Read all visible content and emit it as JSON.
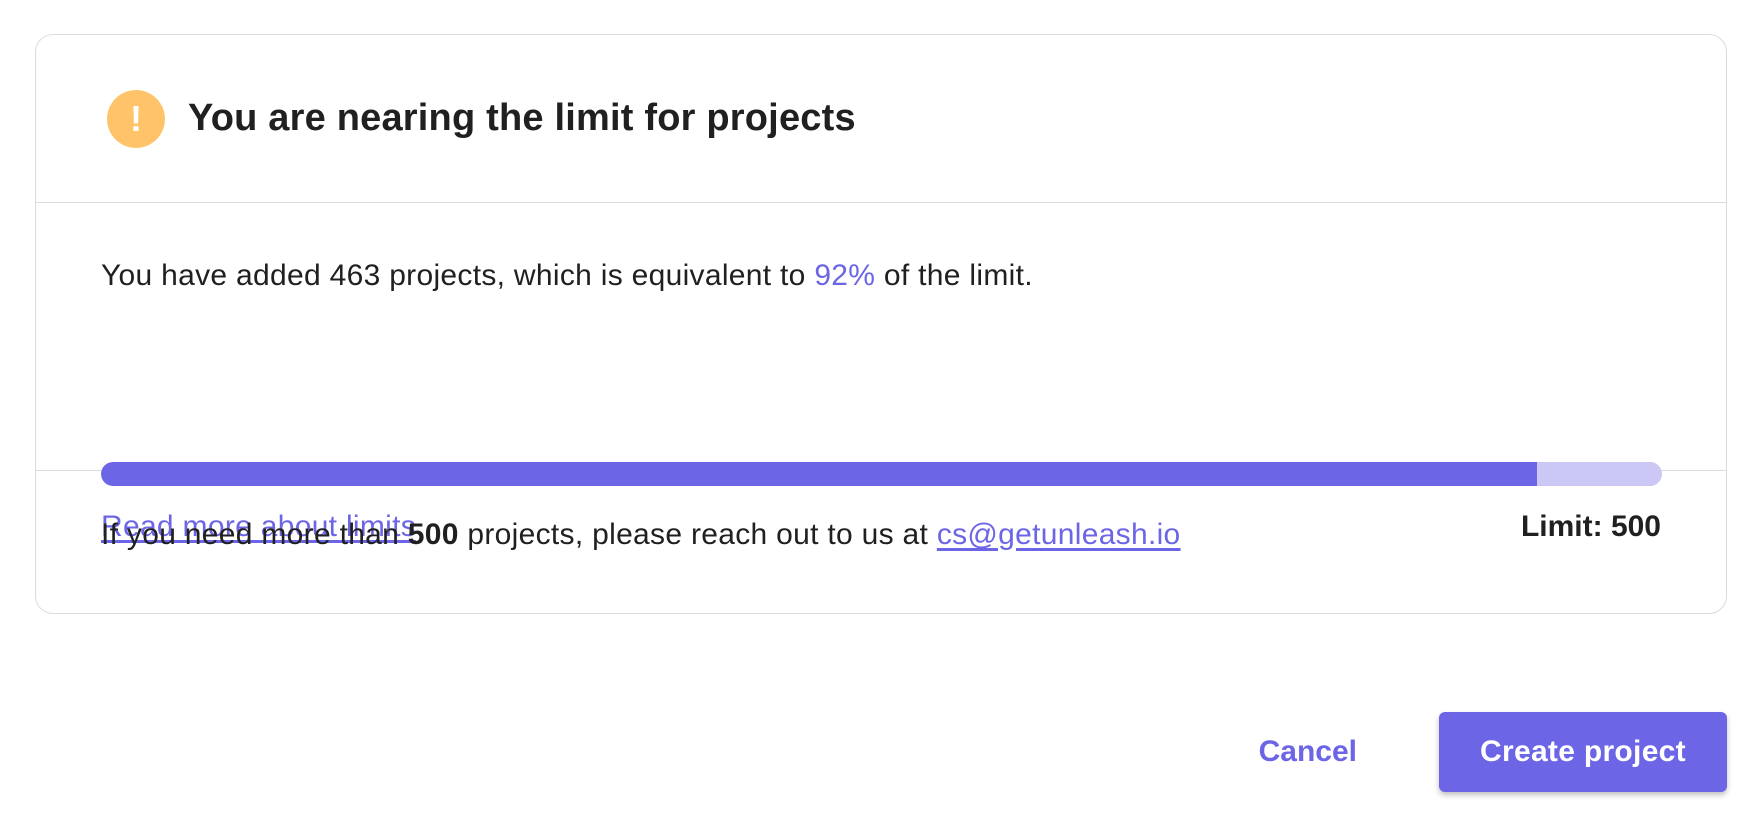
{
  "warning": {
    "icon": "exclamation-icon",
    "icon_glyph": "!",
    "icon_color": "#ffc46a",
    "title": "You are nearing the limit for projects"
  },
  "usage": {
    "text_before": "You have added 463 projects, which is equivalent to ",
    "percent_text": "92%",
    "text_after": " of the limit.",
    "progress_fraction": 0.92,
    "accent_color": "#6c65e5",
    "track_color": "#cbc8f6"
  },
  "links": {
    "read_more": "Read more about limits"
  },
  "limit": {
    "label": "Limit: 500"
  },
  "contact": {
    "text_before": "If you need more than ",
    "bold_value": "500",
    "text_middle": " projects, please reach out to us at ",
    "email": "cs@getunleash.io"
  },
  "actions": {
    "cancel_label": "Cancel",
    "create_label": "Create project"
  }
}
